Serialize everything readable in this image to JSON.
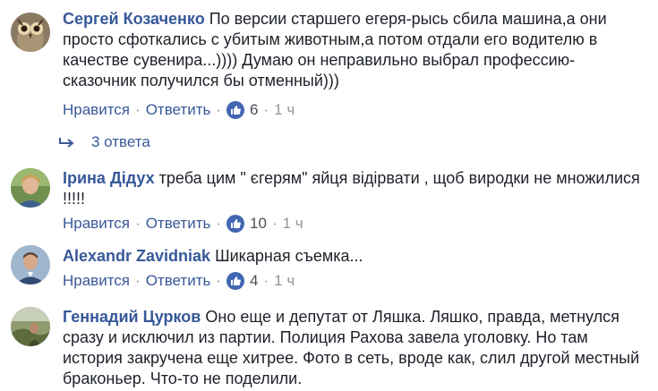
{
  "actions": {
    "like": "Нравится",
    "reply": "Ответить",
    "sep": "·"
  },
  "comments": [
    {
      "author": "Сергей Козаченко",
      "text": "По версии старшего егеря-рысь сбила машина,а они просто сфоткались с убитым животным,а потом отдали его водителю в качестве сувенира...)))) Думаю он неправильно выбрал профессию-сказочник получился бы отменный)))",
      "likes": "6",
      "time": "1 ч",
      "replies": "3 ответа",
      "avatar": "owl-avatar"
    },
    {
      "author": "Ірина Дідух",
      "text": "треба цим \" єгерям\" яйця відірвати , щоб виродки не множилися !!!!!",
      "likes": "10",
      "time": "1 ч",
      "avatar": "woman-avatar"
    },
    {
      "author": "Alexandr Zavidniak",
      "text": "Шикарная съемка...",
      "likes": "4",
      "time": "1 ч",
      "avatar": "man-avatar"
    },
    {
      "author": "Геннадий Цурков",
      "text": "Оно еще и депутат от Ляшка. Ляшко, правда, метнулся сразу и исключил из партии. Полиция Рахова завела уголовку. Но там история закручена еще хитрее. Фото в сеть, вроде как, слил другой местный браконьер. Что-то не поделили.",
      "avatar": "outdoor-avatar"
    }
  ],
  "colors": {
    "link": "#385898",
    "author": "#365899",
    "like_badge": "#4267b2"
  }
}
